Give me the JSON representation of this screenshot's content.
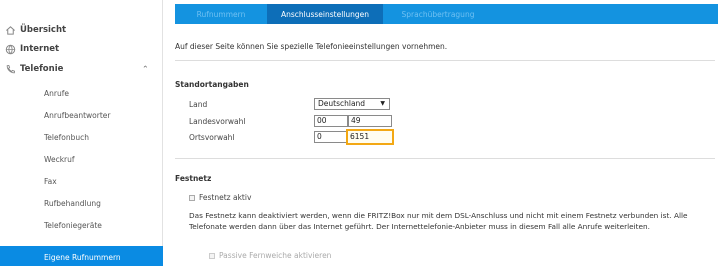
{
  "sidebar": {
    "items": [
      {
        "label": "Übersicht",
        "icon": "home-icon"
      },
      {
        "label": "Internet",
        "icon": "globe-icon"
      },
      {
        "label": "Telefonie",
        "icon": "phone-icon"
      }
    ],
    "expand_indicator": "⌃",
    "subitems": [
      {
        "label": "Anrufe"
      },
      {
        "label": "Anrufbeantworter"
      },
      {
        "label": "Telefonbuch"
      },
      {
        "label": "Weckruf"
      },
      {
        "label": "Fax"
      },
      {
        "label": "Rufbehandlung"
      },
      {
        "label": "Telefoniegeräte"
      },
      {
        "label": "Eigene Rufnummern",
        "active": true
      }
    ],
    "active_color": "#0a8be3"
  },
  "tabs": [
    {
      "label": "Rufnummern",
      "active": false
    },
    {
      "label": "Anschlusseinstellungen",
      "active": true
    },
    {
      "label": "Sprachübertragung",
      "active": false
    }
  ],
  "intro": "Auf dieser Seite können Sie spezielle Telefonieeinstellungen vornehmen.",
  "standort": {
    "title": "Standortangaben",
    "land_label": "Land",
    "land_value": "Deutschland",
    "select_arrow": "▼",
    "landesvorwahl_label": "Landesvorwahl",
    "landesvorwahl_prefix": "00",
    "landesvorwahl_value": "49",
    "ortsvorwahl_label": "Ortsvorwahl",
    "ortsvorwahl_prefix": "0",
    "ortsvorwahl_value": "6151"
  },
  "festnetz": {
    "title": "Festnetz",
    "checkbox_label": "Festnetz aktiv",
    "description": "Das Festnetz kann deaktiviert werden, wenn die FRITZ!Box nur mit dem DSL-Anschluss und nicht mit einem Festnetz verbunden ist. Alle Telefonate werden dann über das Internet geführt. Der Internettelefonie-Anbieter muss in diesem Fall alle Anrufe weiterleiten.",
    "sub_checkbox_label": "Passive Fernweiche aktivieren"
  },
  "colors": {
    "tabbar": "#1493e0",
    "tab_active": "#0d6eb8",
    "focus_border": "#f3a814"
  }
}
